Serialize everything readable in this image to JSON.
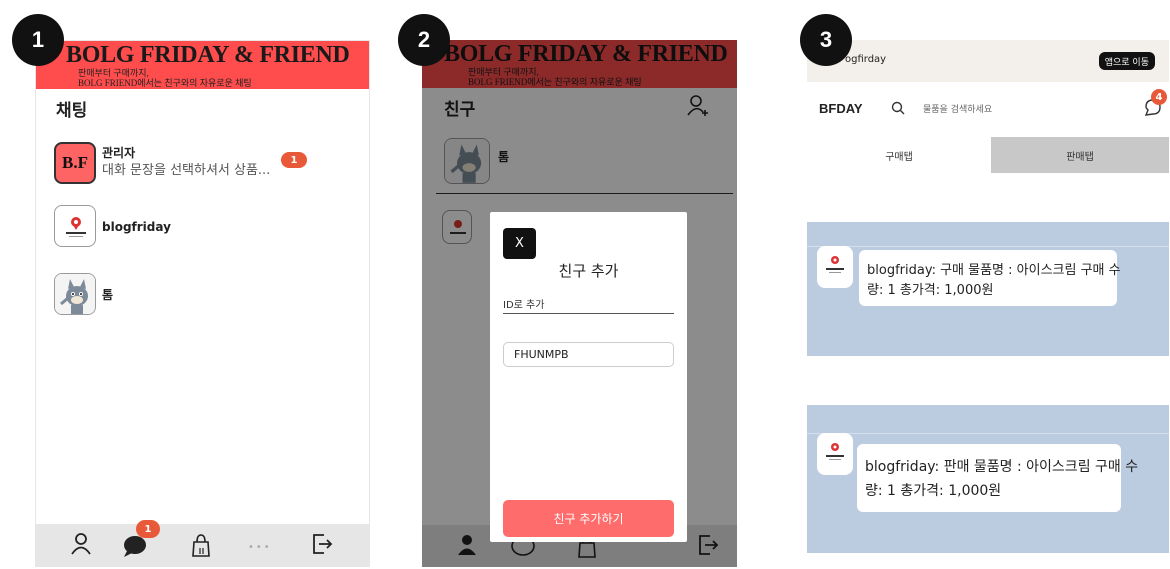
{
  "markers": [
    "1",
    "2",
    "3"
  ],
  "banner": {
    "title": "BOLG FRIDAY & FRIEND",
    "line1": "판매부터 구매까지,",
    "line2": "BOLG FRIEND에서는 친구와의 자유로운 채팅"
  },
  "panel1": {
    "title": "채팅",
    "chats": [
      {
        "name": "관리자",
        "preview": "대화 문장을 선택하셔서 상품...",
        "badge": "1",
        "avatar_text": "B.F"
      },
      {
        "name": "blogfriday",
        "preview": "",
        "badge": ""
      },
      {
        "name": "톰",
        "preview": "",
        "badge": ""
      }
    ],
    "nav_badge": "1"
  },
  "panel2": {
    "title": "친구",
    "friends": [
      "톰"
    ],
    "modal": {
      "close": "X",
      "title": "친구 추가",
      "label": "ID로 추가",
      "input_value": "FHUNMPB",
      "button": "친구 추가하기"
    }
  },
  "panel3": {
    "appbar_name": "blogfirday",
    "appbar_name_visible": "ogfirday",
    "app_button": "앱으로 이동",
    "logo": "BFDAY",
    "search_placeholder": "물품을 검색하세요",
    "notif_count": "4",
    "tabs": [
      {
        "label": "구매탭",
        "active": false
      },
      {
        "label": "판매탭",
        "active": true
      }
    ],
    "messages": [
      {
        "line1": "blogfriday: 구매 물품명 : 아이스크림 구매 수",
        "line2": "량: 1 총가격: 1,000원"
      },
      {
        "line1": "blogfriday: 판매 물품명 : 아이스크림 구매 수",
        "line2": "량: 1 총가격: 1,000원"
      }
    ]
  },
  "colors": {
    "banner": "#ff4c4c",
    "badge": "#e8593a",
    "modal_button": "#ff6c6c",
    "chat_background": "#bccce0",
    "active_tab": "#c8c8c8"
  }
}
